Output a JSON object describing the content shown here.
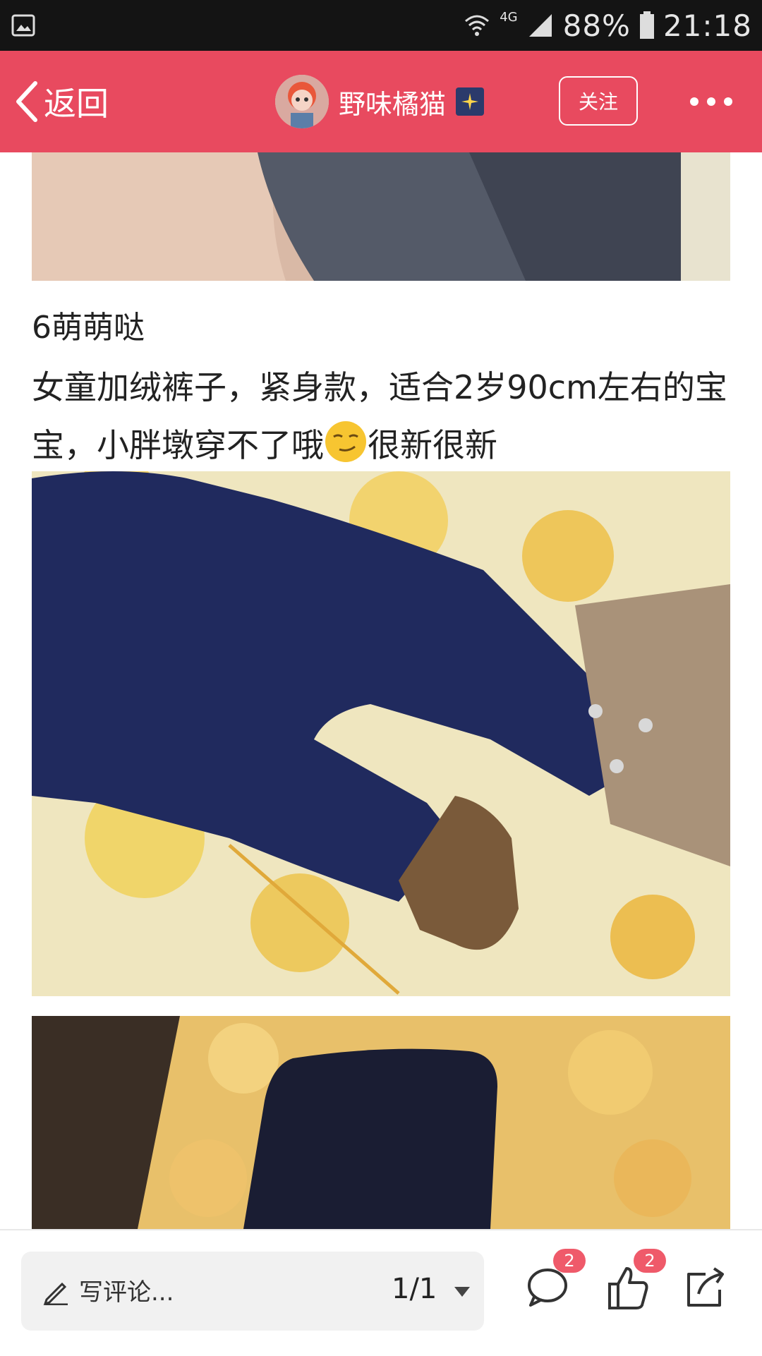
{
  "status_bar": {
    "network": "4G",
    "battery": "88%",
    "time": "21:18"
  },
  "header": {
    "back_label": "返回",
    "username": "野味橘猫",
    "follow_label": "关注",
    "background_color": "#e84a5f"
  },
  "post": {
    "title": "6萌萌哒",
    "description_part1": "女童加绒裤子，紧身款，适合2岁90cm左右的宝宝，小胖墩穿不了哦",
    "description_part2": "很新很新"
  },
  "bottom_bar": {
    "comment_placeholder": "写评论...",
    "page_counter": "1/1",
    "comment_count": "2",
    "like_count": "2",
    "icons": [
      "pencil-icon",
      "chevron-down-icon",
      "comment-icon",
      "thumbs-up-icon",
      "share-icon"
    ]
  }
}
